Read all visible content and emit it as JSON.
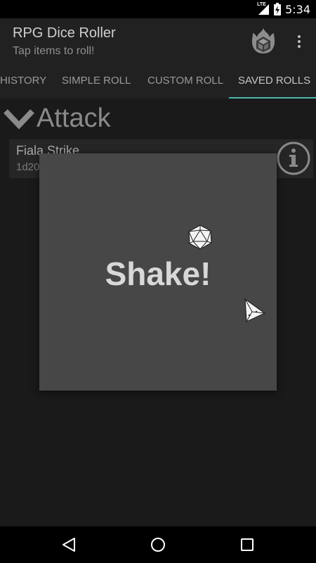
{
  "status_bar": {
    "time": "5:34",
    "network_label": "LTE",
    "icons": [
      "signal-icon",
      "battery-charging-icon"
    ]
  },
  "app_bar": {
    "title": "RPG Dice Roller",
    "subtitle": "Tap items to roll!",
    "icons": [
      "dice-fire-logo-icon",
      "overflow-menu-icon"
    ]
  },
  "tabs": [
    {
      "label": "HISTORY",
      "active": false
    },
    {
      "label": "SIMPLE ROLL",
      "active": false
    },
    {
      "label": "CUSTOM ROLL",
      "active": false
    },
    {
      "label": "SAVED ROLLS",
      "active": true
    }
  ],
  "accent_color": "#4db6ac",
  "saved_rolls": {
    "group": {
      "title": "Attack",
      "expanded": true,
      "items": [
        {
          "name": "Fiala Strike",
          "formula": "1d20"
        }
      ]
    }
  },
  "dialog": {
    "message": "Shake!",
    "icons": [
      "d20-die-icon",
      "d4-die-icon"
    ]
  },
  "nav_bar": {
    "icons": [
      "back-icon",
      "home-icon",
      "recents-icon"
    ]
  }
}
